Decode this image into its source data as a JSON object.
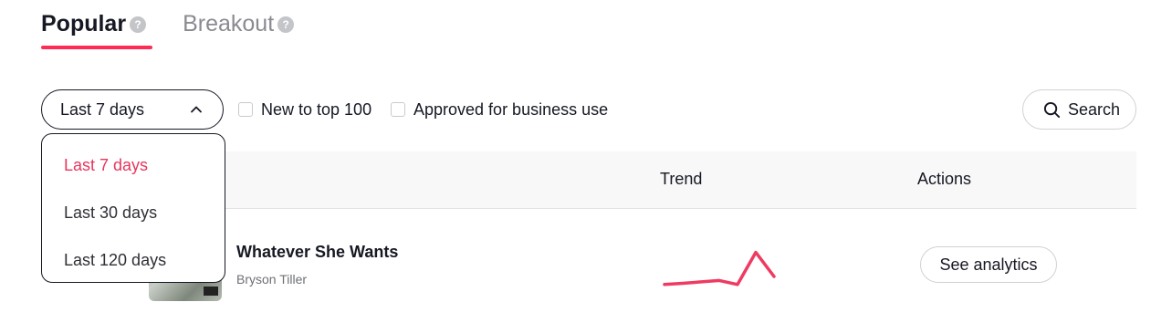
{
  "tabs": [
    {
      "label": "Popular",
      "active": true
    },
    {
      "label": "Breakout",
      "active": false
    }
  ],
  "help_icon_glyph": "?",
  "filters": {
    "period_selected": "Last 7 days",
    "checkbox_new": {
      "label": "New to top 100",
      "checked": false
    },
    "checkbox_business": {
      "label": "Approved for business use",
      "checked": false
    },
    "search_label": "Search"
  },
  "period_menu": {
    "options": [
      "Last 7 days",
      "Last 30 days",
      "Last 120 days"
    ],
    "selected_index": 0
  },
  "table": {
    "headers": {
      "trend": "Trend",
      "actions": "Actions"
    },
    "rows": [
      {
        "title": "Whatever She Wants",
        "artist": "Bryson Tiller",
        "action_label": "See analytics",
        "trend": [
          0.05,
          0.08,
          0.15,
          0.05,
          0.85,
          0.25
        ]
      }
    ]
  },
  "colors": {
    "accent": "#fe2c55",
    "trend_line": "#ee3b62",
    "text": "#161823",
    "muted": "#8a8b91"
  },
  "icons": [
    "help-icon",
    "chevron-up-icon",
    "search-icon"
  ]
}
